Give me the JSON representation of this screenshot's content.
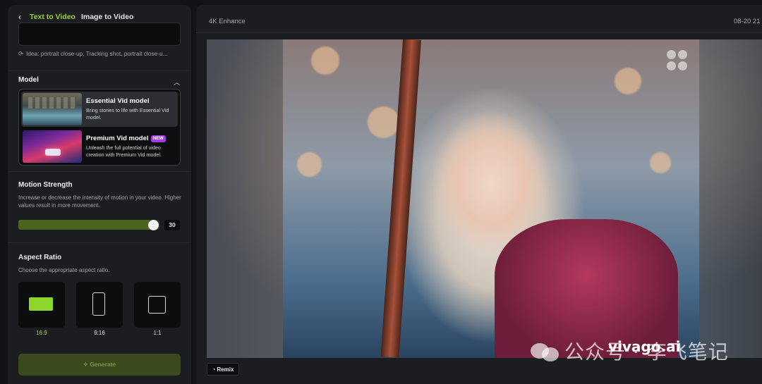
{
  "tabs": {
    "back_icon": "chevron-left-icon",
    "active": "Text to Video",
    "other": "Image to Video"
  },
  "prompt": {
    "value": ""
  },
  "idea": {
    "icon": "refresh-icon",
    "text": "Idea: portrait close-up, Tracking shot, portrait close-u..."
  },
  "model": {
    "title": "Model",
    "items": [
      {
        "name": "Essential Vid model",
        "desc": "Bring stories to life with Essential Vid model."
      },
      {
        "name": "Premium Vid model",
        "badge": "NEW",
        "desc": "Unleash the full potential of video creation with Premium Vid model."
      }
    ]
  },
  "motion": {
    "title": "Motion Strength",
    "desc": "Increase or decrease the intensity of motion in your video. Higher values result in more movement.",
    "value": "30",
    "fraction": 0.93
  },
  "aspect": {
    "title": "Aspect Ratio",
    "desc": "Choose the appropriate aspect ratio.",
    "options": [
      "16:9",
      "9:16",
      "1:1"
    ],
    "selected": "16:9",
    "accent": "#8ed629"
  },
  "generate": {
    "label": "Generate",
    "icon": "sparkle-icon"
  },
  "viewer": {
    "title": "4K Enhance",
    "date": "08-20 21",
    "remix_label": "Remix"
  },
  "watermark": {
    "wechat_text": "公众号 · 李飞笔记",
    "brand": "vivago.ai"
  }
}
